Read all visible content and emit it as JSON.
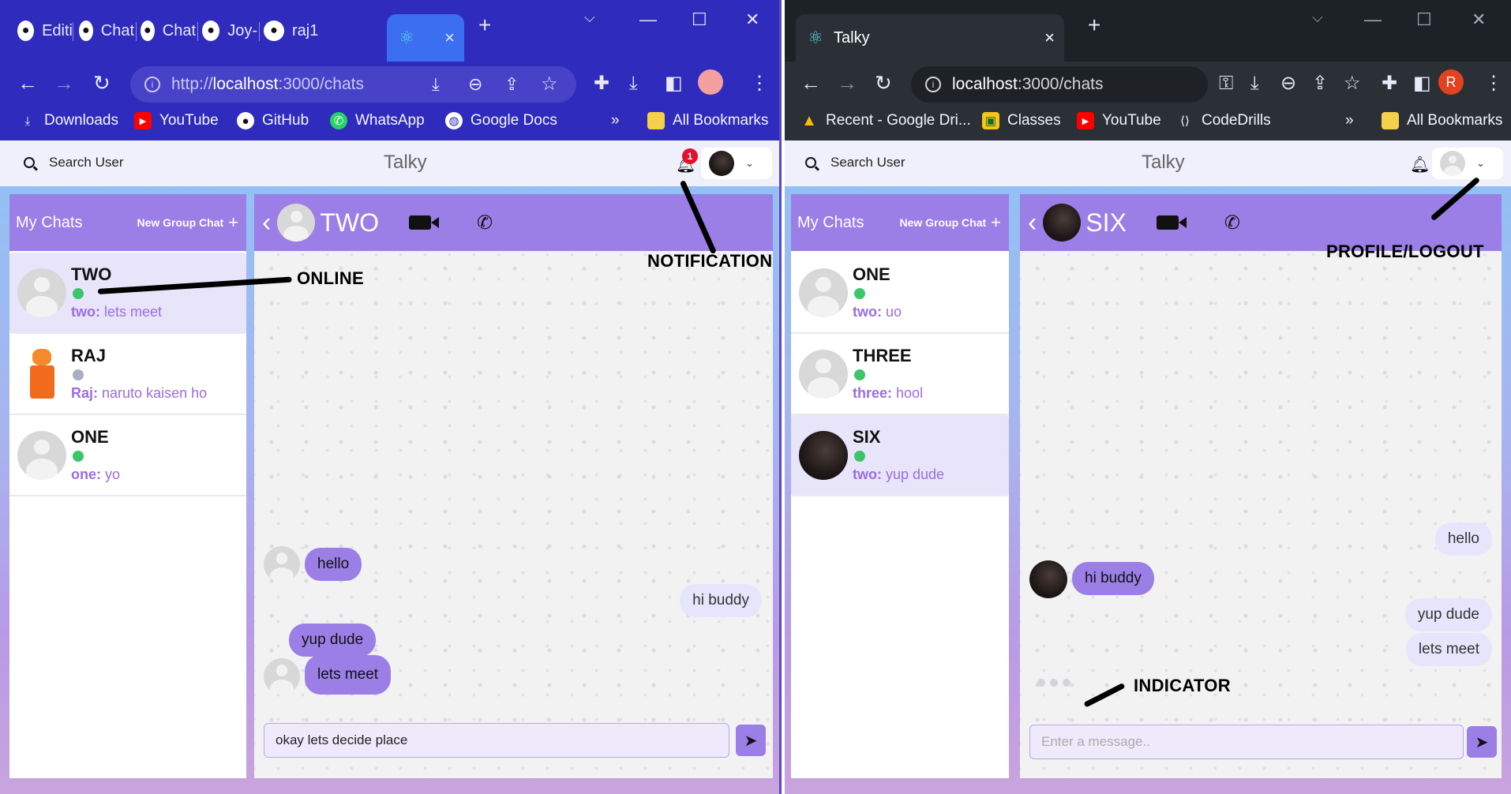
{
  "left": {
    "tabs": [
      "Editi",
      "Chat",
      "Chat",
      "Joy-",
      "raj1"
    ],
    "active_tab": {
      "title": "",
      "close": "×"
    },
    "new_tab": "+",
    "url": {
      "scheme": "http://",
      "host": "localhost",
      "rest": ":3000/chats"
    },
    "bookmarks": [
      "Downloads",
      "YouTube",
      "GitHub",
      "WhatsApp",
      "Google Docs"
    ],
    "overflow": "»",
    "all_bookmarks": "All Bookmarks",
    "app": {
      "search_label": "Search User",
      "brand": "Talky",
      "notif_count": "1",
      "my_chats": "My Chats",
      "new_group": "New Group Chat",
      "plus": "+",
      "chats": [
        {
          "name": "TWO",
          "status": "online",
          "sender": "two:",
          "msg": "lets meet"
        },
        {
          "name": "RAJ",
          "status": "offline",
          "sender": "Raj:",
          "msg": "naruto kaisen ho"
        },
        {
          "name": "ONE",
          "status": "online",
          "sender": "one:",
          "msg": "yo"
        }
      ],
      "chat_title": "TWO",
      "messages": [
        {
          "text": "hello",
          "side": "in"
        },
        {
          "text": "hi buddy",
          "side": "out"
        },
        {
          "text": "yup dude",
          "side": "in"
        },
        {
          "text": "lets meet",
          "side": "in"
        }
      ],
      "composer_value": "okay lets decide place"
    },
    "annotations": {
      "online": "ONLINE",
      "notification": "NOTIFICATION"
    }
  },
  "right": {
    "tab_title": "Talky",
    "close": "×",
    "new_tab": "+",
    "url": {
      "host": "localhost",
      "rest": ":3000/chats"
    },
    "profile_letter": "R",
    "bookmarks": [
      "Recent - Google Dri...",
      "Classes",
      "YouTube",
      "CodeDrills"
    ],
    "overflow": "»",
    "all_bookmarks": "All Bookmarks",
    "app": {
      "search_label": "Search User",
      "brand": "Talky",
      "my_chats": "My Chats",
      "new_group": "New Group Chat",
      "plus": "+",
      "chats": [
        {
          "name": "ONE",
          "status": "online",
          "sender": "two:",
          "msg": "uo"
        },
        {
          "name": "THREE",
          "status": "online",
          "sender": "three:",
          "msg": "hool"
        },
        {
          "name": "SIX",
          "status": "online",
          "sender": "two:",
          "msg": "yup dude"
        }
      ],
      "chat_title": "SIX",
      "messages": [
        {
          "text": "hello",
          "side": "out"
        },
        {
          "text": "hi buddy",
          "side": "in"
        },
        {
          "text": "yup dude",
          "side": "out"
        },
        {
          "text": "lets meet",
          "side": "out"
        }
      ],
      "composer_placeholder": "Enter a message.."
    },
    "annotations": {
      "profile": "PROFILE/LOGOUT",
      "indicator": "INDICATOR"
    }
  },
  "colors": {
    "accent": "#9b7ee6",
    "online": "#3cc66a",
    "badge": "#e0132d"
  }
}
